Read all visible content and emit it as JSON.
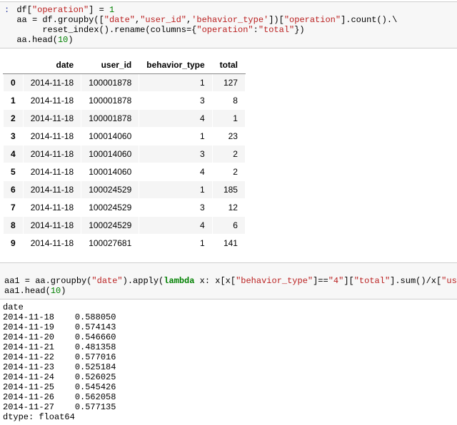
{
  "code1_prefix": ":",
  "code1_line1_html": "df[<span class='s-str'>\"operation\"</span>] = <span class='s-num'>1</span>",
  "code1_line2_html": "aa = df.groupby([<span class='s-str'>\"date\"</span>,<span class='s-str'>\"user_id\"</span>,<span class='s-str'>'behavior_type'</span>])[<span class='s-str'>\"operation\"</span>].count().\\",
  "code1_line3_html": "     reset_index().rename(columns={<span class='s-str'>\"operation\"</span>:<span class='s-str'>\"total\"</span>})",
  "code1_line4_html": "aa.head(<span class='s-num'>10</span>)",
  "table": {
    "columns": [
      "",
      "date",
      "user_id",
      "behavior_type",
      "total"
    ],
    "rows": [
      [
        "0",
        "2014-11-18",
        "100001878",
        "1",
        "127"
      ],
      [
        "1",
        "2014-11-18",
        "100001878",
        "3",
        "8"
      ],
      [
        "2",
        "2014-11-18",
        "100001878",
        "4",
        "1"
      ],
      [
        "3",
        "2014-11-18",
        "100014060",
        "1",
        "23"
      ],
      [
        "4",
        "2014-11-18",
        "100014060",
        "3",
        "2"
      ],
      [
        "5",
        "2014-11-18",
        "100014060",
        "4",
        "2"
      ],
      [
        "6",
        "2014-11-18",
        "100024529",
        "1",
        "185"
      ],
      [
        "7",
        "2014-11-18",
        "100024529",
        "3",
        "12"
      ],
      [
        "8",
        "2014-11-18",
        "100024529",
        "4",
        "6"
      ],
      [
        "9",
        "2014-11-18",
        "100027681",
        "1",
        "141"
      ]
    ]
  },
  "code2_line1_html": "aa1 = aa.groupby(<span class='s-str'>\"date\"</span>).apply(<span class='s-kw'>lambda</span> x: x[x[<span class='s-str'>\"behavior_type\"</span>]==<span class='s-str'>\"4\"</span>][<span class='s-str'>\"total\"</span>].sum()/x[<span class='s-str'>\"user_id\"</span>].nunique())",
  "code2_line2_html": "aa1.head(<span class='s-num'>10</span>)",
  "series": {
    "name": "date",
    "dtype": "dtype: float64",
    "items": [
      [
        "2014-11-18",
        "0.588050"
      ],
      [
        "2014-11-19",
        "0.574143"
      ],
      [
        "2014-11-20",
        "0.546660"
      ],
      [
        "2014-11-21",
        "0.481358"
      ],
      [
        "2014-11-22",
        "0.577016"
      ],
      [
        "2014-11-23",
        "0.525184"
      ],
      [
        "2014-11-24",
        "0.526025"
      ],
      [
        "2014-11-25",
        "0.545426"
      ],
      [
        "2014-11-26",
        "0.562058"
      ],
      [
        "2014-11-27",
        "0.577135"
      ]
    ]
  },
  "chart_data": {
    "type": "table",
    "title": "aa.head(10)",
    "columns": [
      "date",
      "user_id",
      "behavior_type",
      "total"
    ],
    "index": [
      0,
      1,
      2,
      3,
      4,
      5,
      6,
      7,
      8,
      9
    ],
    "rows": [
      [
        "2014-11-18",
        100001878,
        1,
        127
      ],
      [
        "2014-11-18",
        100001878,
        3,
        8
      ],
      [
        "2014-11-18",
        100001878,
        4,
        1
      ],
      [
        "2014-11-18",
        100014060,
        1,
        23
      ],
      [
        "2014-11-18",
        100014060,
        3,
        2
      ],
      [
        "2014-11-18",
        100014060,
        4,
        2
      ],
      [
        "2014-11-18",
        100024529,
        1,
        185
      ],
      [
        "2014-11-18",
        100024529,
        3,
        12
      ],
      [
        "2014-11-18",
        100024529,
        4,
        6
      ],
      [
        "2014-11-18",
        100027681,
        1,
        141
      ]
    ]
  }
}
